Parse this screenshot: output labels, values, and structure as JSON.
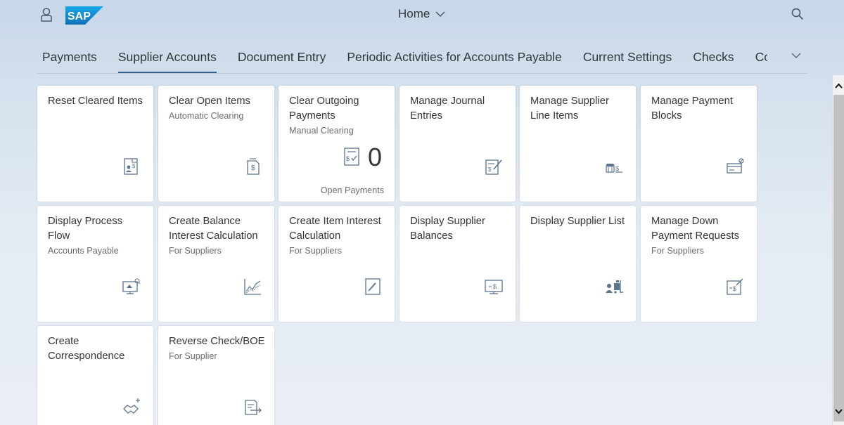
{
  "header": {
    "title": "Home",
    "logo_text": "SAP",
    "logo_color": "#1a8fd6"
  },
  "tabs": [
    {
      "label": "Payments"
    },
    {
      "label": "Supplier Accounts",
      "active": true
    },
    {
      "label": "Document Entry"
    },
    {
      "label": "Periodic Activities for Accounts Payable"
    },
    {
      "label": "Current Settings"
    },
    {
      "label": "Checks"
    },
    {
      "label": "Co"
    }
  ],
  "tiles": [
    {
      "title": "Reset Cleared Items",
      "subtitle": "",
      "icon": "document-dollar-icon"
    },
    {
      "title": "Clear Open Items",
      "subtitle": "Automatic Clearing",
      "icon": "dollar-page-icon"
    },
    {
      "title": "Clear Outgoing Payments",
      "subtitle": "Manual Clearing",
      "icon": "payment-list-icon",
      "kpi_value": "0",
      "kpi_footer": "Open Payments"
    },
    {
      "title": "Manage Journal Entries",
      "subtitle": "",
      "icon": "edit-dollar-icon"
    },
    {
      "title": "Manage Supplier Line Items",
      "subtitle": "",
      "icon": "supplier-lines-icon"
    },
    {
      "title": "Manage Payment Blocks",
      "subtitle": "",
      "icon": "blocked-card-icon"
    },
    {
      "title": "Display Process Flow",
      "subtitle": "Accounts Payable",
      "icon": "process-flow-monitor-icon"
    },
    {
      "title": "Create Balance Interest Calculation",
      "subtitle": "For Suppliers",
      "icon": "line-chart-icon"
    },
    {
      "title": "Create Item Interest Calculation",
      "subtitle": "For Suppliers",
      "icon": "edit-document-icon"
    },
    {
      "title": "Display Supplier Balances",
      "subtitle": "",
      "icon": "monitor-dollar-icon"
    },
    {
      "title": "Display Supplier List",
      "subtitle": "",
      "icon": "supplier-forklift-icon"
    },
    {
      "title": "Manage Down Payment Requests",
      "subtitle": "For Suppliers",
      "icon": "dollar-request-icon"
    },
    {
      "title": "Create Correspondence",
      "subtitle": "",
      "icon": "handshake-icon"
    },
    {
      "title": "Reverse Check/BOE",
      "subtitle": "For Supplier",
      "icon": "reverse-document-icon"
    }
  ]
}
